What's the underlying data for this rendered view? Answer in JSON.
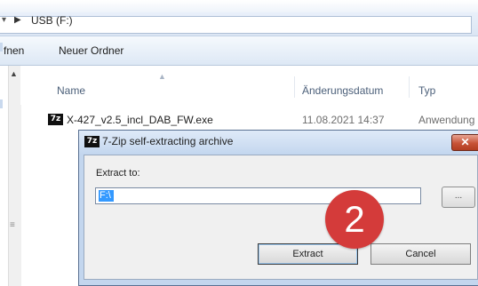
{
  "explorer": {
    "address": {
      "arrow": "▶",
      "path": "USB (F:)"
    },
    "toolbar": {
      "open_label_partial": "fnen",
      "new_folder_label": "Neuer Ordner"
    },
    "columns": {
      "name": "Name",
      "date": "Änderungsdatum",
      "type": "Typ"
    },
    "file": {
      "icon": "7z",
      "name": "X-427_v2.5_incl_DAB_FW.exe",
      "date": "11.08.2021 14:37",
      "type": "Anwendung"
    }
  },
  "dialog": {
    "icon": "7z",
    "title": "7-Zip self-extracting archive",
    "close_glyph": "✕",
    "extract_to_label": "Extract to:",
    "path_value": "F:\\",
    "browse_label": "...",
    "extract_button": "Extract",
    "cancel_button": "Cancel"
  },
  "annotation": {
    "step_number": "2",
    "color": "#d43b3a"
  }
}
